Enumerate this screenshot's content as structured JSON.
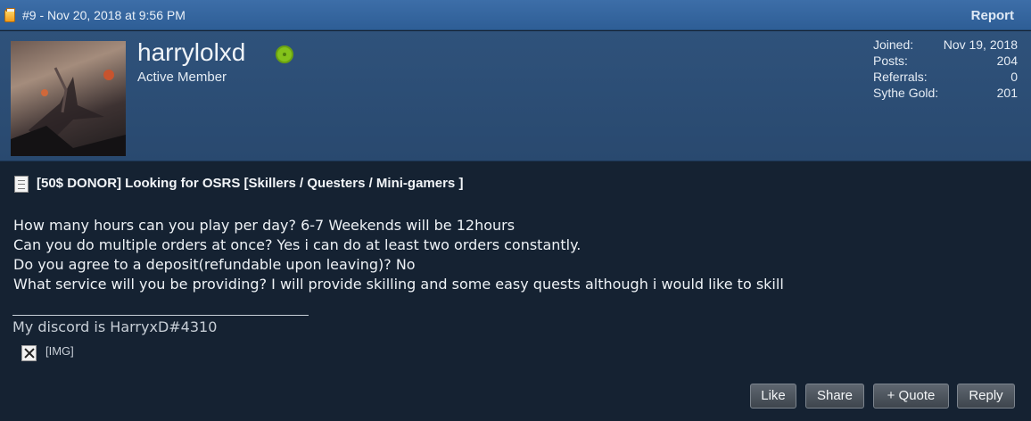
{
  "post": {
    "meta": "#9 - Nov 20, 2018 at 9:56 PM",
    "report_label": "Report"
  },
  "user": {
    "name": "harrylolxd",
    "title": "Active Member",
    "online_color": "#84c21b",
    "stats": [
      {
        "label": "Joined:",
        "value": "Nov 19, 2018"
      },
      {
        "label": "Posts:",
        "value": "204"
      },
      {
        "label": "Referrals:",
        "value": "0"
      },
      {
        "label": "Sythe Gold:",
        "value": "201"
      }
    ]
  },
  "content": {
    "thread_title": "[50$ DONOR] Looking for OSRS [Skillers / Questers / Mini-gamers ]",
    "lines": [
      "How many hours can you play per day? 6-7 Weekends will be 12hours",
      "Can you do multiple orders at once? Yes i can do at least two orders constantly.",
      "Do you agree to a deposit(refundable upon leaving)? No",
      "What service will you be providing? I will provide skilling and some easy quests although i would like to skill"
    ],
    "signature": "My discord is HarryxD#4310",
    "broken_image_label": "[IMG]"
  },
  "actions": {
    "like": "Like",
    "share": "Share",
    "quote": "+ Quote",
    "reply": "Reply"
  },
  "colors": {
    "topbar": "#3d6ea8",
    "userbar": "#2f527b",
    "background": "#152232"
  }
}
